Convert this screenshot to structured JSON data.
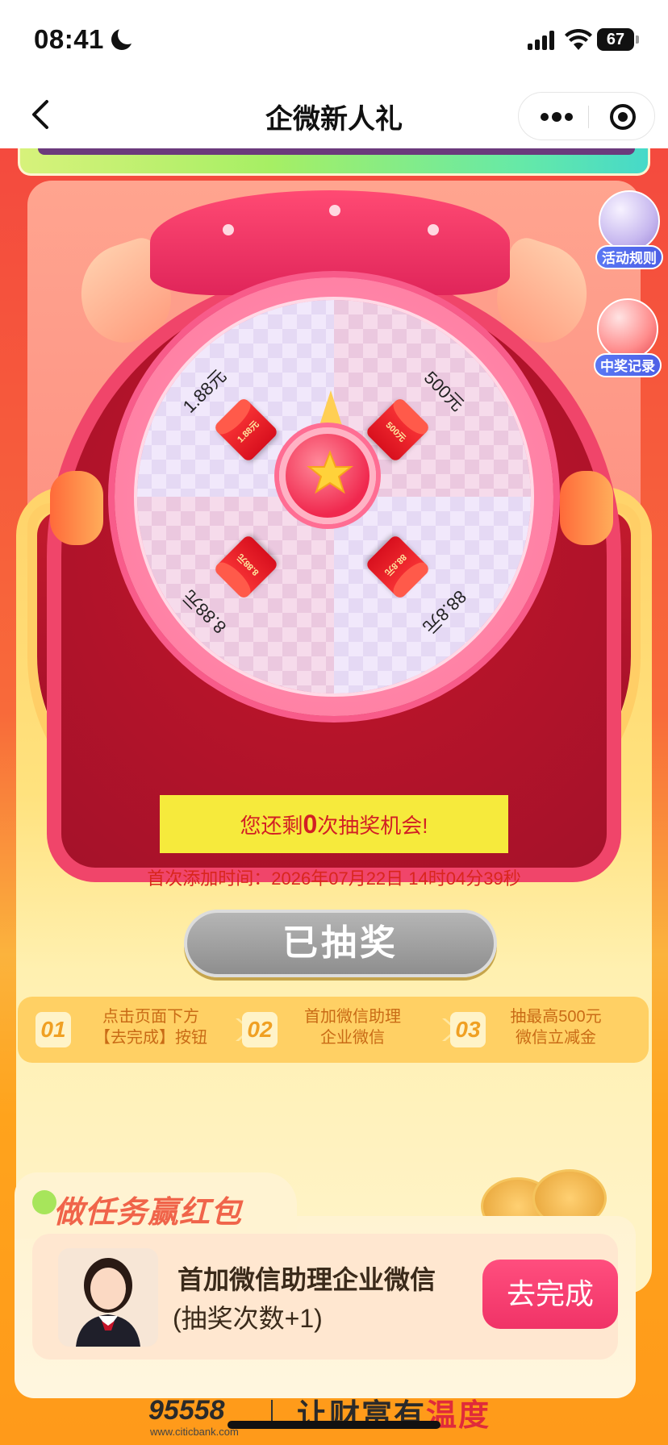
{
  "status": {
    "time": "08:41",
    "battery": "67"
  },
  "nav": {
    "title": "企微新人礼"
  },
  "floating": {
    "rules_label": "活动规则",
    "records_label": "中奖记录"
  },
  "wheel": {
    "prizes": [
      {
        "label": "1.88元",
        "envelope": "1.88元"
      },
      {
        "label": "500元",
        "envelope": "500元"
      },
      {
        "label": "8.88元",
        "envelope": "8.88元"
      },
      {
        "label": "88.8元",
        "envelope": "88.8元"
      }
    ]
  },
  "draw": {
    "chances_prefix": "您还剩",
    "chances_count": "0",
    "chances_suffix": "次抽奖机会!",
    "added_time": "首次添加时间：2026年07月22日 14时04分39秒",
    "button_label": "已抽奖"
  },
  "steps": [
    {
      "num": "01",
      "line1": "点击页面下方",
      "line2": "【去完成】按钮"
    },
    {
      "num": "02",
      "line1": "首加微信助理",
      "line2": "企业微信"
    },
    {
      "num": "03",
      "line1": "抽最高500元",
      "line2": "微信立减金"
    }
  ],
  "task": {
    "section_title": "做任务赢红包",
    "title": "首加微信助理企业微信",
    "subtitle": "(抽奖次数+1)",
    "button_label": "去完成"
  },
  "footer": {
    "hotline": "95558",
    "url": "www.citicbank.com",
    "slogan_a": "让财富有",
    "slogan_b": "温度"
  },
  "colors": {
    "accent": "#f03367",
    "chances_bg": "#f6ea3c",
    "disabled_button": "#9e9e9e"
  }
}
